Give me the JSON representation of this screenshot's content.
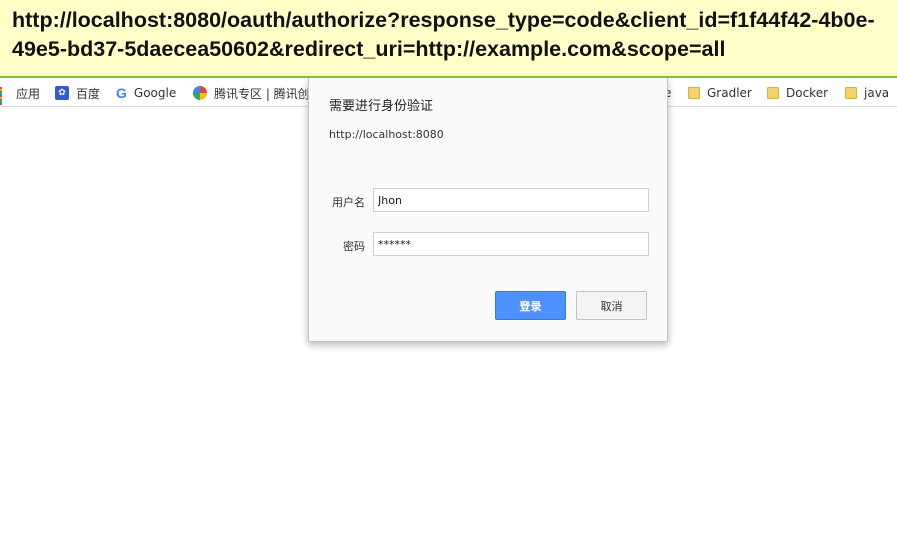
{
  "url_banner": {
    "text": "http://localhost:8080/oauth/authorize?response_type=code&client_id=f1f44f42-4b0e-49e5-bd37-5daecea50602&redirect_uri=http://example.com&scope=all",
    "background": "#ffffc8",
    "underline_color": "#7ac143"
  },
  "bookmarks": [
    {
      "label": "应用",
      "icon": "apps-grid-icon"
    },
    {
      "label": "百度",
      "icon": "baidu-paw-icon"
    },
    {
      "label": "Google",
      "icon": "google-icon"
    },
    {
      "label": "腾讯专区 | 腾讯创",
      "icon": "tencent-icon"
    },
    {
      "label": "e",
      "icon": ""
    },
    {
      "label": "Gradler",
      "icon": "folder-icon"
    },
    {
      "label": "Docker",
      "icon": "folder-icon"
    },
    {
      "label": "java",
      "icon": "folder-icon"
    }
  ],
  "dialog": {
    "title": "需要进行身份验证",
    "origin": "http://localhost:8080",
    "username_label": "用户名",
    "username_value": "Jhon",
    "password_label": "密码",
    "password_value": "******",
    "login_label": "登录",
    "cancel_label": "取消",
    "accent_color": "#4d90fe"
  }
}
